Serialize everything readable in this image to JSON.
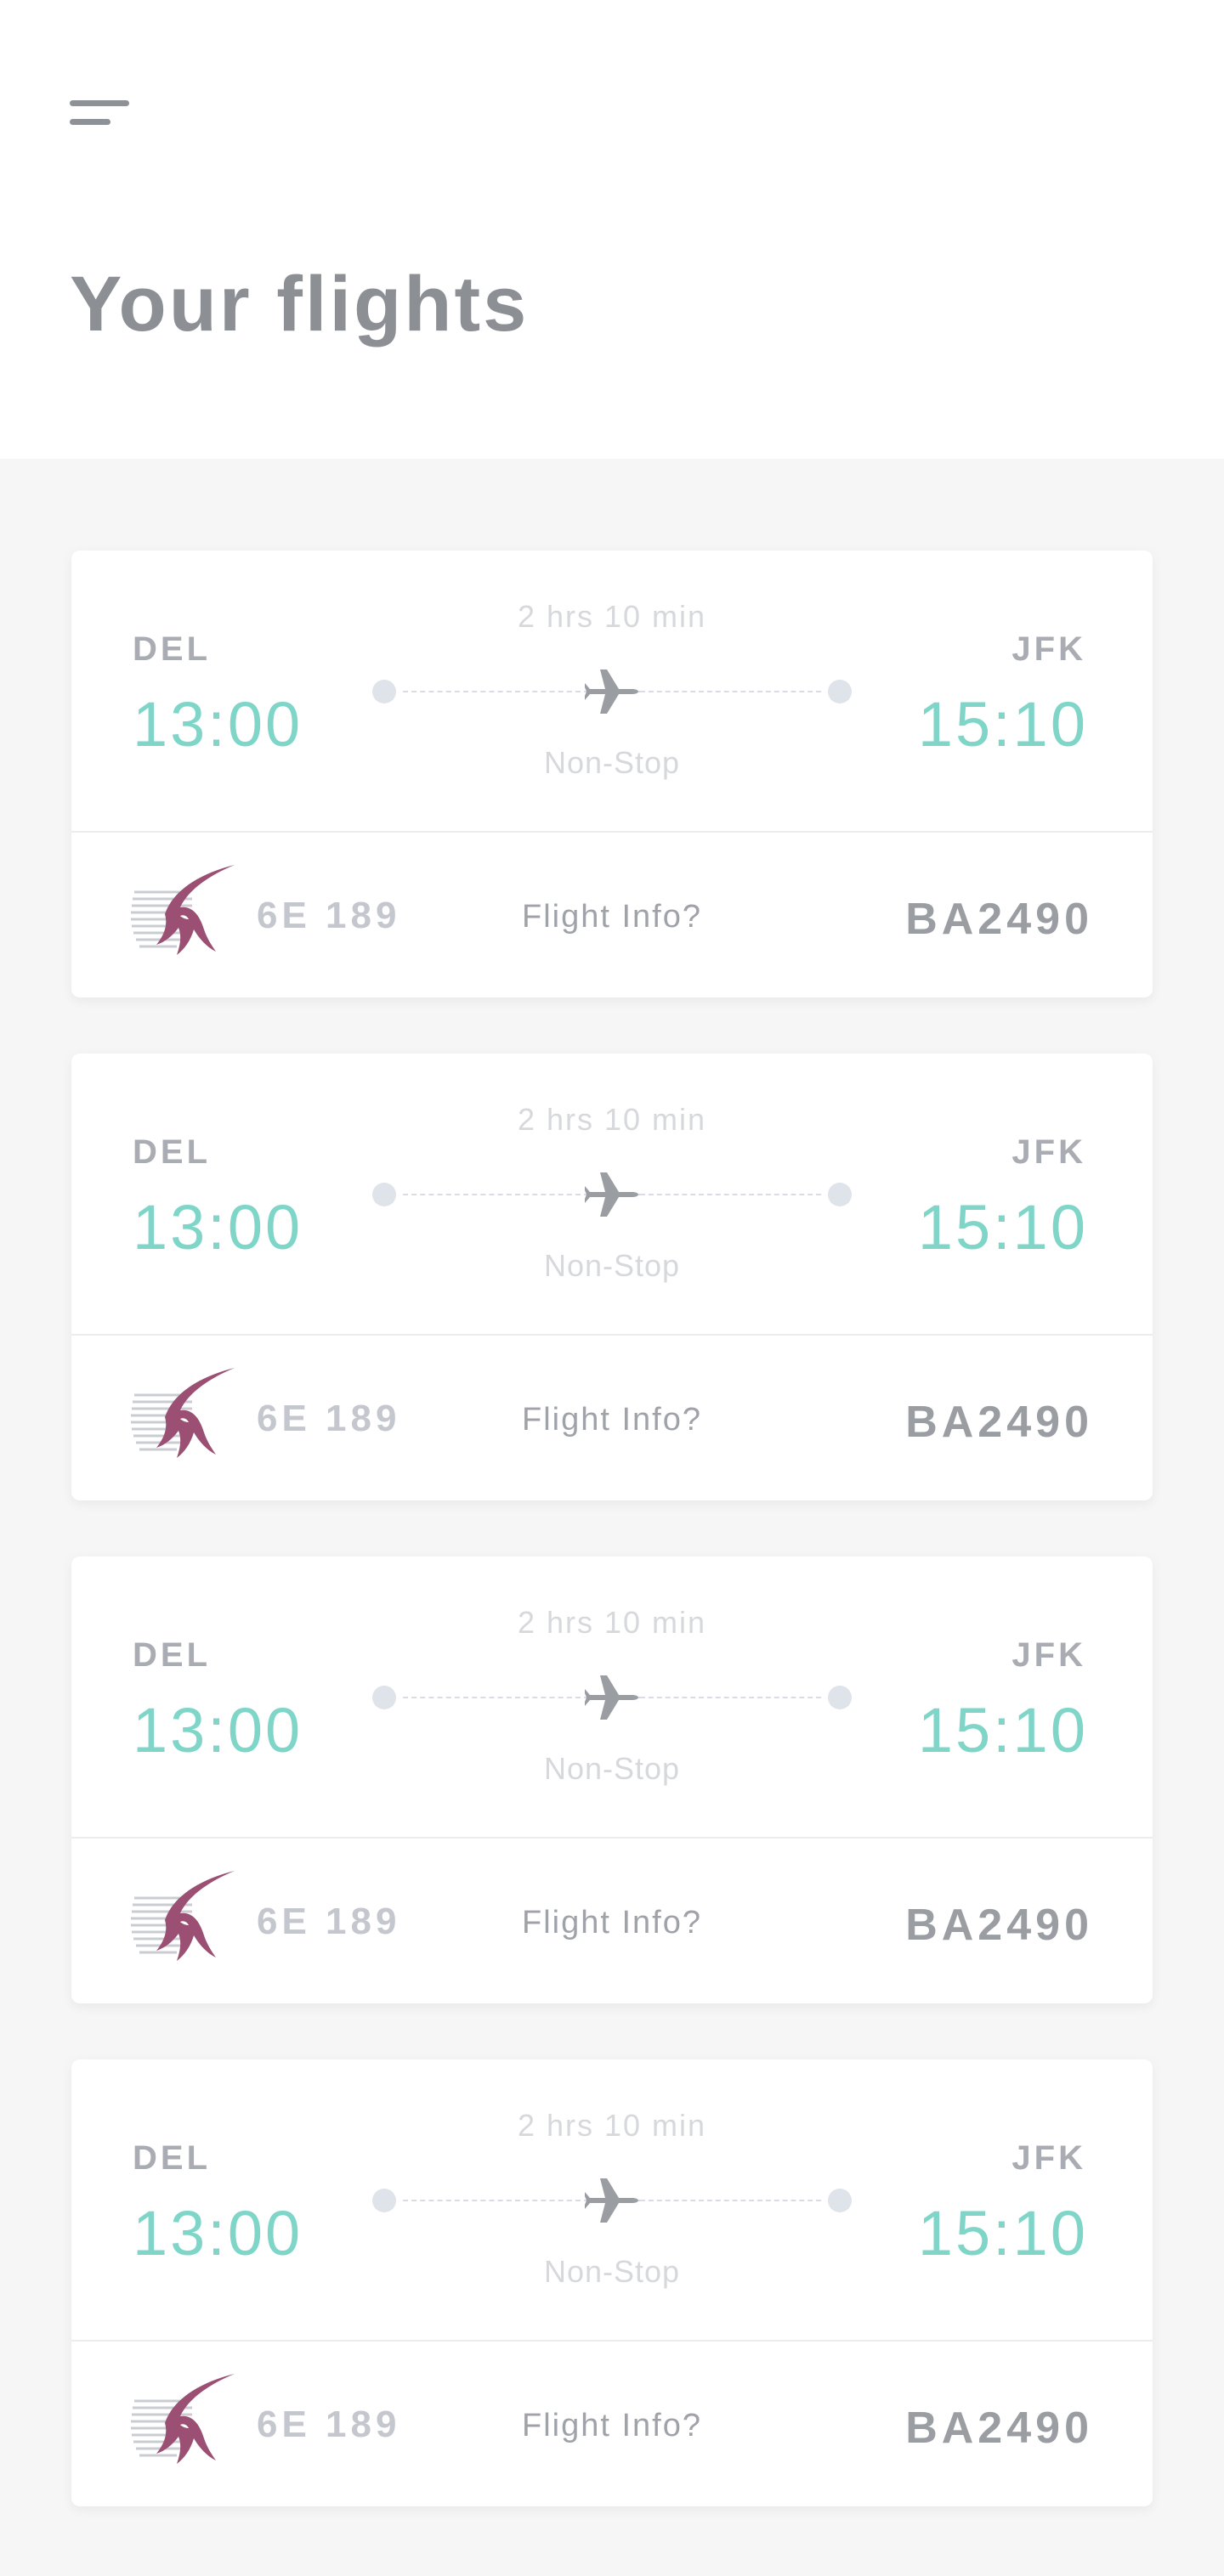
{
  "page": {
    "title": "Your flights"
  },
  "header": {
    "menu_icon": "hamburger-menu-icon"
  },
  "colors": {
    "accent_time": "#7fd6c8",
    "title": "#8c9095",
    "logo": "#9a4f73"
  },
  "flights": [
    {
      "from_code": "DEL",
      "to_code": "JFK",
      "departure_time": "13:00",
      "arrival_time": "15:10",
      "duration": "2 hrs 10 min",
      "stops": "Non-Stop",
      "flight_number": "6E 189",
      "info_label": "Flight Info?",
      "booking_ref": "BA2490",
      "airline_icon": "airline-logo-icon"
    },
    {
      "from_code": "DEL",
      "to_code": "JFK",
      "departure_time": "13:00",
      "arrival_time": "15:10",
      "duration": "2 hrs 10 min",
      "stops": "Non-Stop",
      "flight_number": "6E 189",
      "info_label": "Flight Info?",
      "booking_ref": "BA2490",
      "airline_icon": "airline-logo-icon"
    },
    {
      "from_code": "DEL",
      "to_code": "JFK",
      "departure_time": "13:00",
      "arrival_time": "15:10",
      "duration": "2 hrs 10 min",
      "stops": "Non-Stop",
      "flight_number": "6E 189",
      "info_label": "Flight Info?",
      "booking_ref": "BA2490",
      "airline_icon": "airline-logo-icon"
    },
    {
      "from_code": "DEL",
      "to_code": "JFK",
      "departure_time": "13:00",
      "arrival_time": "15:10",
      "duration": "2 hrs 10 min",
      "stops": "Non-Stop",
      "flight_number": "6E 189",
      "info_label": "Flight Info?",
      "booking_ref": "BA2490",
      "airline_icon": "airline-logo-icon"
    }
  ]
}
